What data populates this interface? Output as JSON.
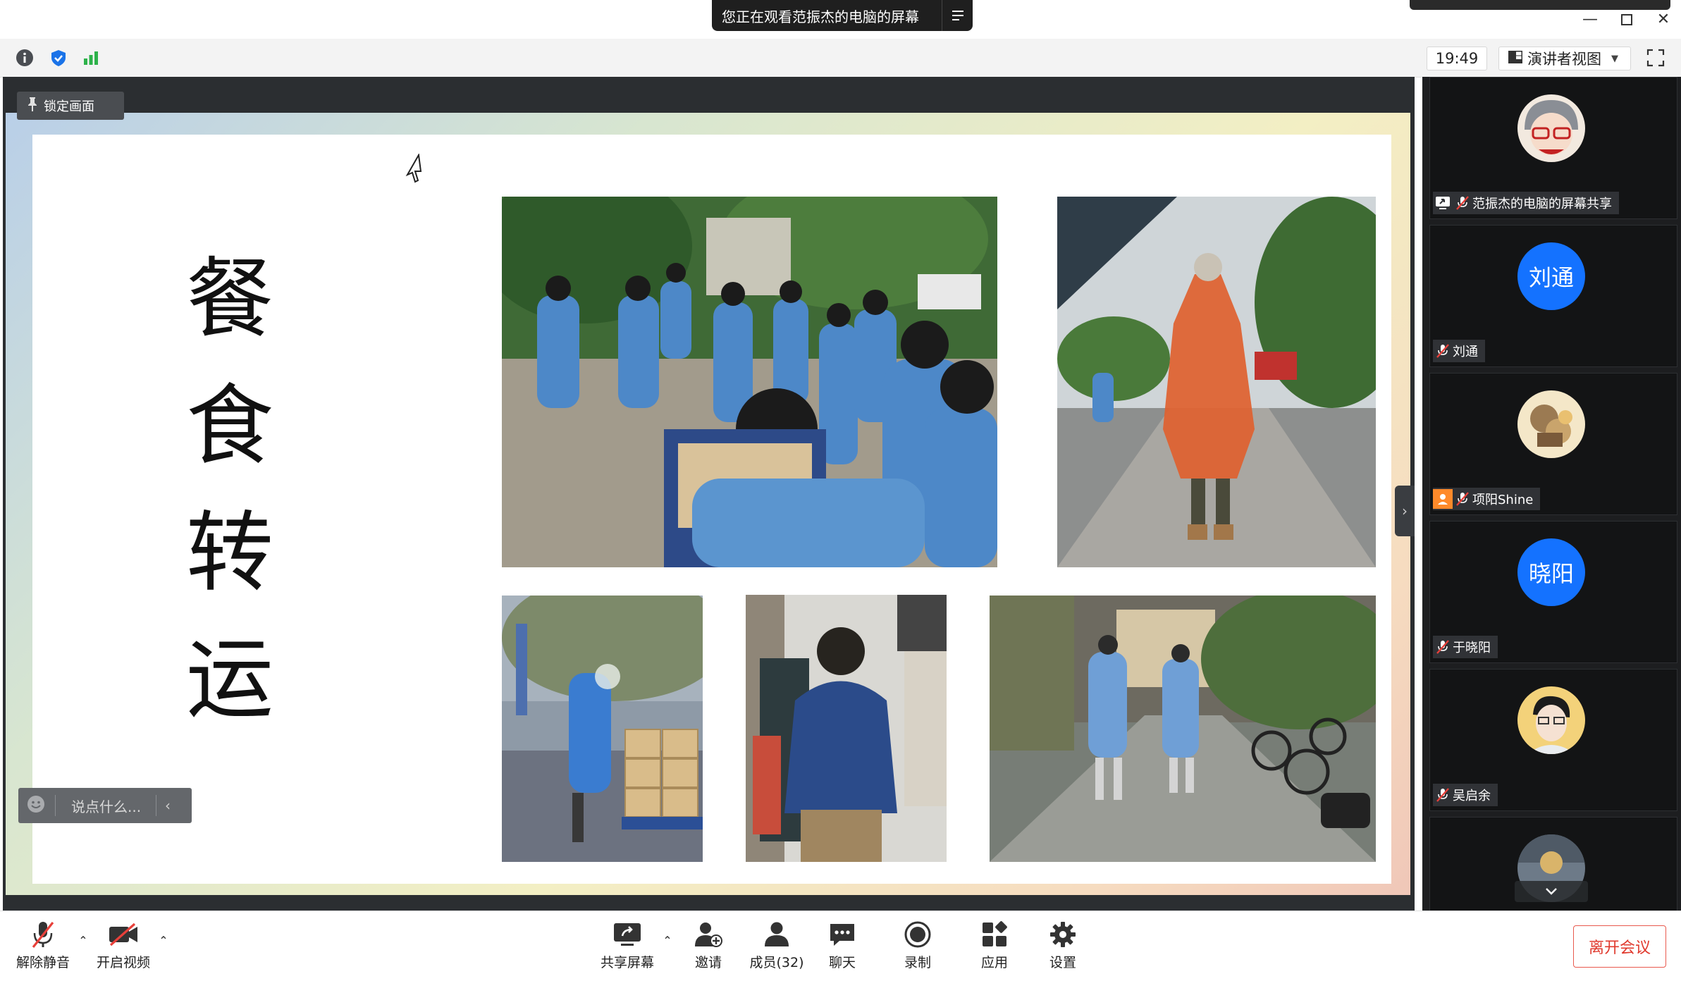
{
  "share_banner": {
    "text": "您正在观看范振杰的电脑的屏幕"
  },
  "toolbar": {
    "clock": "19:49",
    "view_mode": "演讲者视图"
  },
  "share": {
    "lock_label": "锁定画面",
    "chat_placeholder": "说点什么...",
    "slide_title_chars": [
      "餐",
      "食",
      "转",
      "运"
    ]
  },
  "participants": [
    {
      "name": "范振杰的电脑的屏幕共享",
      "avatar": "cartoon-avatar",
      "sharing": true
    },
    {
      "name": "刘通",
      "avatar_text": "刘通",
      "avatar_color": "#1472ff"
    },
    {
      "name": "项阳Shine",
      "avatar": "bear-avatar"
    },
    {
      "name": "于晓阳",
      "avatar_text": "晓阳",
      "avatar_color": "#1472ff"
    },
    {
      "name": "吴启余",
      "avatar": "photo-avatar"
    }
  ],
  "controls": {
    "unmute": "解除静音",
    "start_video": "开启视频",
    "share_screen": "共享屏幕",
    "invite": "邀请",
    "members": "成员(32)",
    "chat": "聊天",
    "record": "录制",
    "apps": "应用",
    "settings": "设置",
    "leave": "离开会议"
  },
  "colors": {
    "accent_blue": "#1472ff",
    "leave_red": "#e0392d",
    "panel_bg": "#1d1e20"
  }
}
